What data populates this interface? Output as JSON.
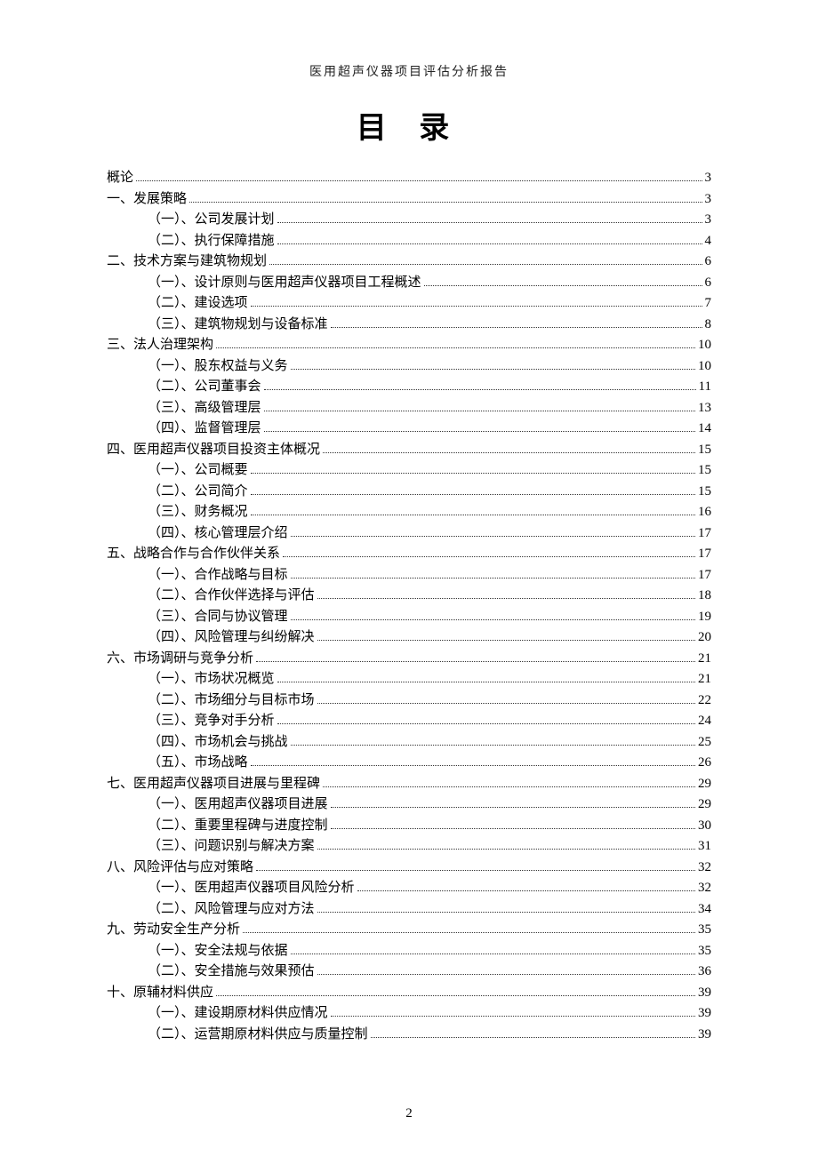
{
  "running_header": "医用超声仪器项目评估分析报告",
  "title": "目 录",
  "page_number": "2",
  "toc": [
    {
      "level": 0,
      "label": "概论",
      "page": "3"
    },
    {
      "level": 0,
      "label": "一、发展策略",
      "page": "3"
    },
    {
      "level": 1,
      "label": "（一）、公司发展计划",
      "page": "3"
    },
    {
      "level": 1,
      "label": "（二）、执行保障措施",
      "page": "4"
    },
    {
      "level": 0,
      "label": "二、技术方案与建筑物规划",
      "page": "6"
    },
    {
      "level": 1,
      "label": "（一）、设计原则与医用超声仪器项目工程概述",
      "page": "6"
    },
    {
      "level": 1,
      "label": "（二）、建设选项",
      "page": "7"
    },
    {
      "level": 1,
      "label": "（三）、建筑物规划与设备标准",
      "page": "8"
    },
    {
      "level": 0,
      "label": "三、法人治理架构",
      "page": "10"
    },
    {
      "level": 1,
      "label": "（一）、股东权益与义务",
      "page": "10"
    },
    {
      "level": 1,
      "label": "（二）、公司董事会",
      "page": "11"
    },
    {
      "level": 1,
      "label": "（三）、高级管理层",
      "page": "13"
    },
    {
      "level": 1,
      "label": "（四）、监督管理层",
      "page": "14"
    },
    {
      "level": 0,
      "label": "四、医用超声仪器项目投资主体概况",
      "page": "15"
    },
    {
      "level": 1,
      "label": "（一）、公司概要",
      "page": "15"
    },
    {
      "level": 1,
      "label": "（二）、公司简介",
      "page": "15"
    },
    {
      "level": 1,
      "label": "（三）、财务概况",
      "page": "16"
    },
    {
      "level": 1,
      "label": "（四）、核心管理层介绍",
      "page": "17"
    },
    {
      "level": 0,
      "label": "五、战略合作与合作伙伴关系",
      "page": "17"
    },
    {
      "level": 1,
      "label": "（一）、合作战略与目标",
      "page": "17"
    },
    {
      "level": 1,
      "label": "（二）、合作伙伴选择与评估",
      "page": "18"
    },
    {
      "level": 1,
      "label": "（三）、合同与协议管理",
      "page": "19"
    },
    {
      "level": 1,
      "label": "（四）、风险管理与纠纷解决",
      "page": "20"
    },
    {
      "level": 0,
      "label": "六、市场调研与竞争分析",
      "page": "21"
    },
    {
      "level": 1,
      "label": "（一）、市场状况概览",
      "page": "21"
    },
    {
      "level": 1,
      "label": "（二）、市场细分与目标市场",
      "page": "22"
    },
    {
      "level": 1,
      "label": "（三）、竞争对手分析",
      "page": "24"
    },
    {
      "level": 1,
      "label": "（四）、市场机会与挑战",
      "page": "25"
    },
    {
      "level": 1,
      "label": "（五）、市场战略",
      "page": "26"
    },
    {
      "level": 0,
      "label": "七、医用超声仪器项目进展与里程碑",
      "page": "29"
    },
    {
      "level": 1,
      "label": "（一）、医用超声仪器项目进展",
      "page": "29"
    },
    {
      "level": 1,
      "label": "（二）、重要里程碑与进度控制",
      "page": "30"
    },
    {
      "level": 1,
      "label": "（三）、问题识别与解决方案",
      "page": "31"
    },
    {
      "level": 0,
      "label": "八、风险评估与应对策略",
      "page": "32"
    },
    {
      "level": 1,
      "label": "（一）、医用超声仪器项目风险分析",
      "page": "32"
    },
    {
      "level": 1,
      "label": "（二）、风险管理与应对方法",
      "page": "34"
    },
    {
      "level": 0,
      "label": "九、劳动安全生产分析",
      "page": "35"
    },
    {
      "level": 1,
      "label": "（一）、安全法规与依据",
      "page": "35"
    },
    {
      "level": 1,
      "label": "（二）、安全措施与效果预估",
      "page": "36"
    },
    {
      "level": 0,
      "label": "十、原辅材料供应",
      "page": "39"
    },
    {
      "level": 1,
      "label": "（一）、建设期原材料供应情况",
      "page": "39"
    },
    {
      "level": 1,
      "label": "（二）、运营期原材料供应与质量控制",
      "page": "39"
    }
  ]
}
